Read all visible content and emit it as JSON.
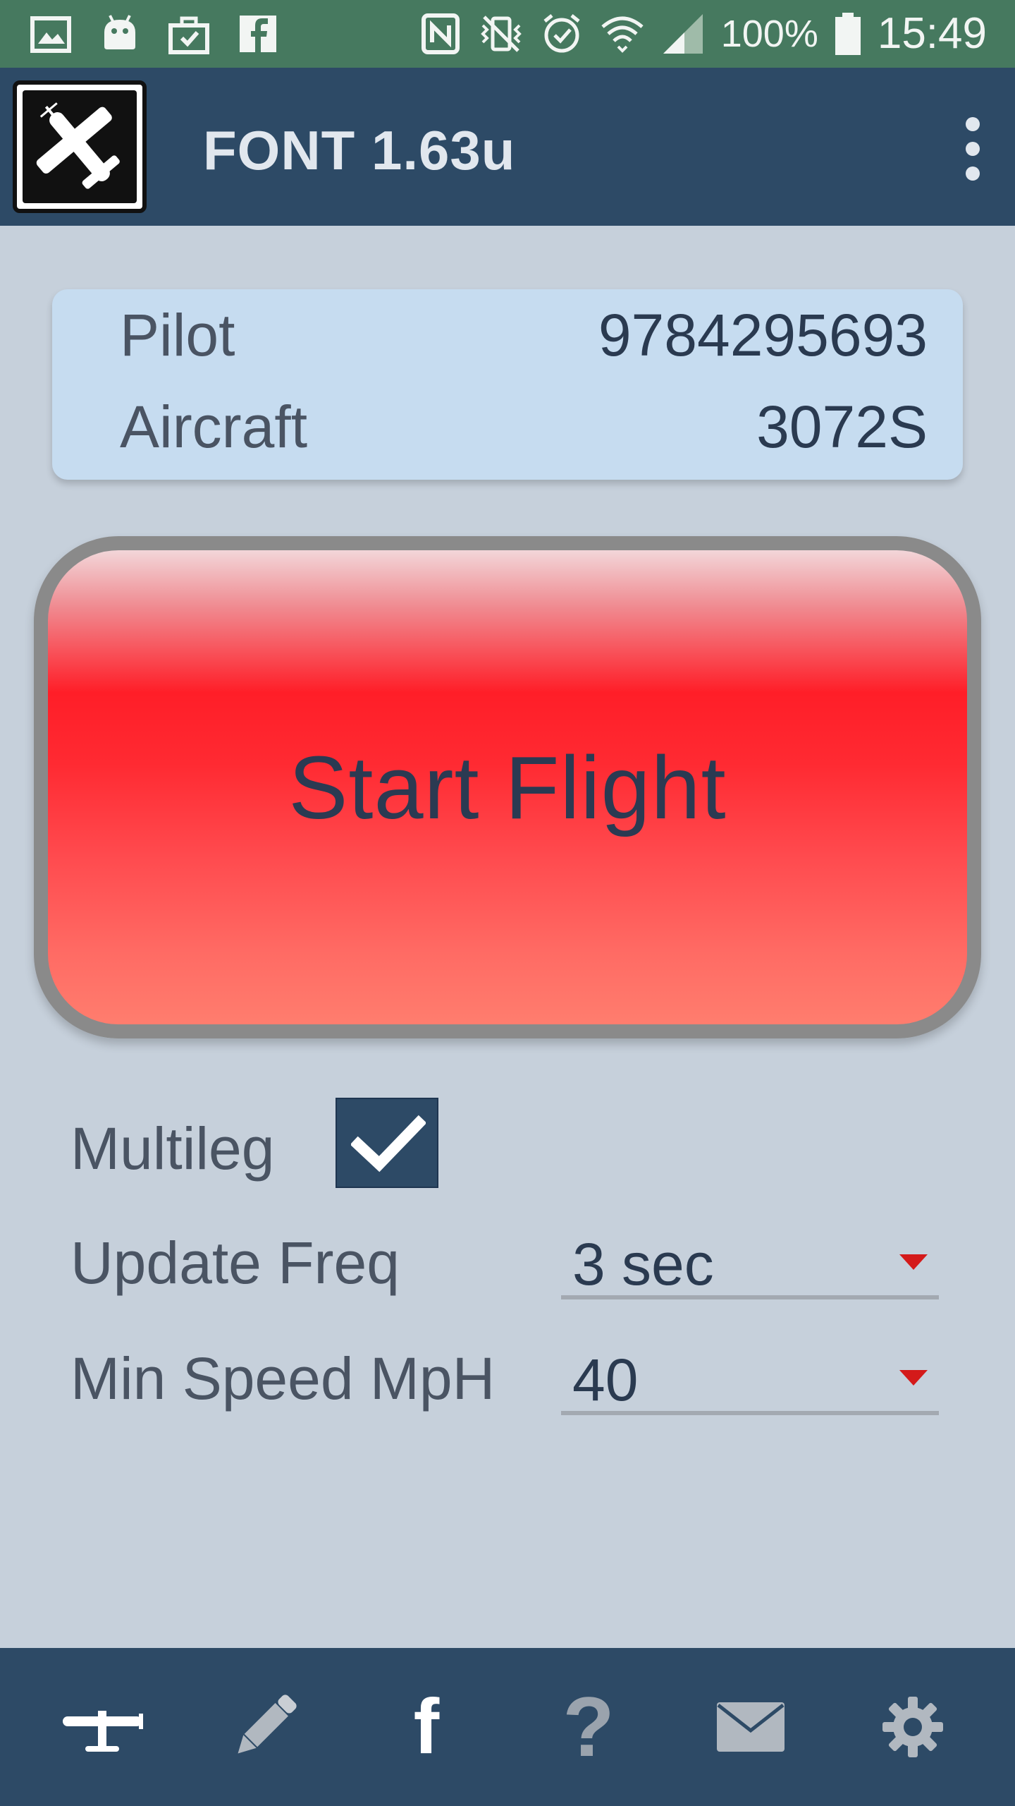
{
  "status_bar": {
    "battery": "100%",
    "time": "15:49",
    "icons": [
      "gallery-icon",
      "android-icon",
      "briefcase-icon",
      "facebook-icon",
      "nfc-icon",
      "vibrate-icon",
      "alarm-icon",
      "wifi-icon",
      "signal-icon",
      "battery-icon"
    ]
  },
  "app_bar": {
    "title": "FONT 1.63u",
    "logo_icon": "airplane-icon",
    "menu_icon": "overflow-menu-icon"
  },
  "info": {
    "pilot_label": "Pilot",
    "pilot_value": "9784295693",
    "aircraft_label": "Aircraft",
    "aircraft_value": "3072S"
  },
  "start_button": {
    "label": "Start Flight"
  },
  "settings": {
    "multileg_label": "Multileg",
    "multileg_checked": true,
    "update_freq_label": "Update Freq",
    "update_freq_value": "3 sec",
    "min_speed_label": "Min Speed MpH",
    "min_speed_value": "40"
  },
  "bottom_nav": {
    "items": [
      "airplane-icon",
      "pencil-icon",
      "facebook-icon",
      "help-icon",
      "mail-icon",
      "settings-icon"
    ],
    "facebook_glyph": "f",
    "help_glyph": "?"
  },
  "colors": {
    "status_bar": "#46795f",
    "app_bar": "#2d4a66",
    "background": "#c6d0db",
    "card": "#c6dcf0",
    "button_red": "#ff1e28",
    "dropdown_arrow": "#d41a1a"
  }
}
